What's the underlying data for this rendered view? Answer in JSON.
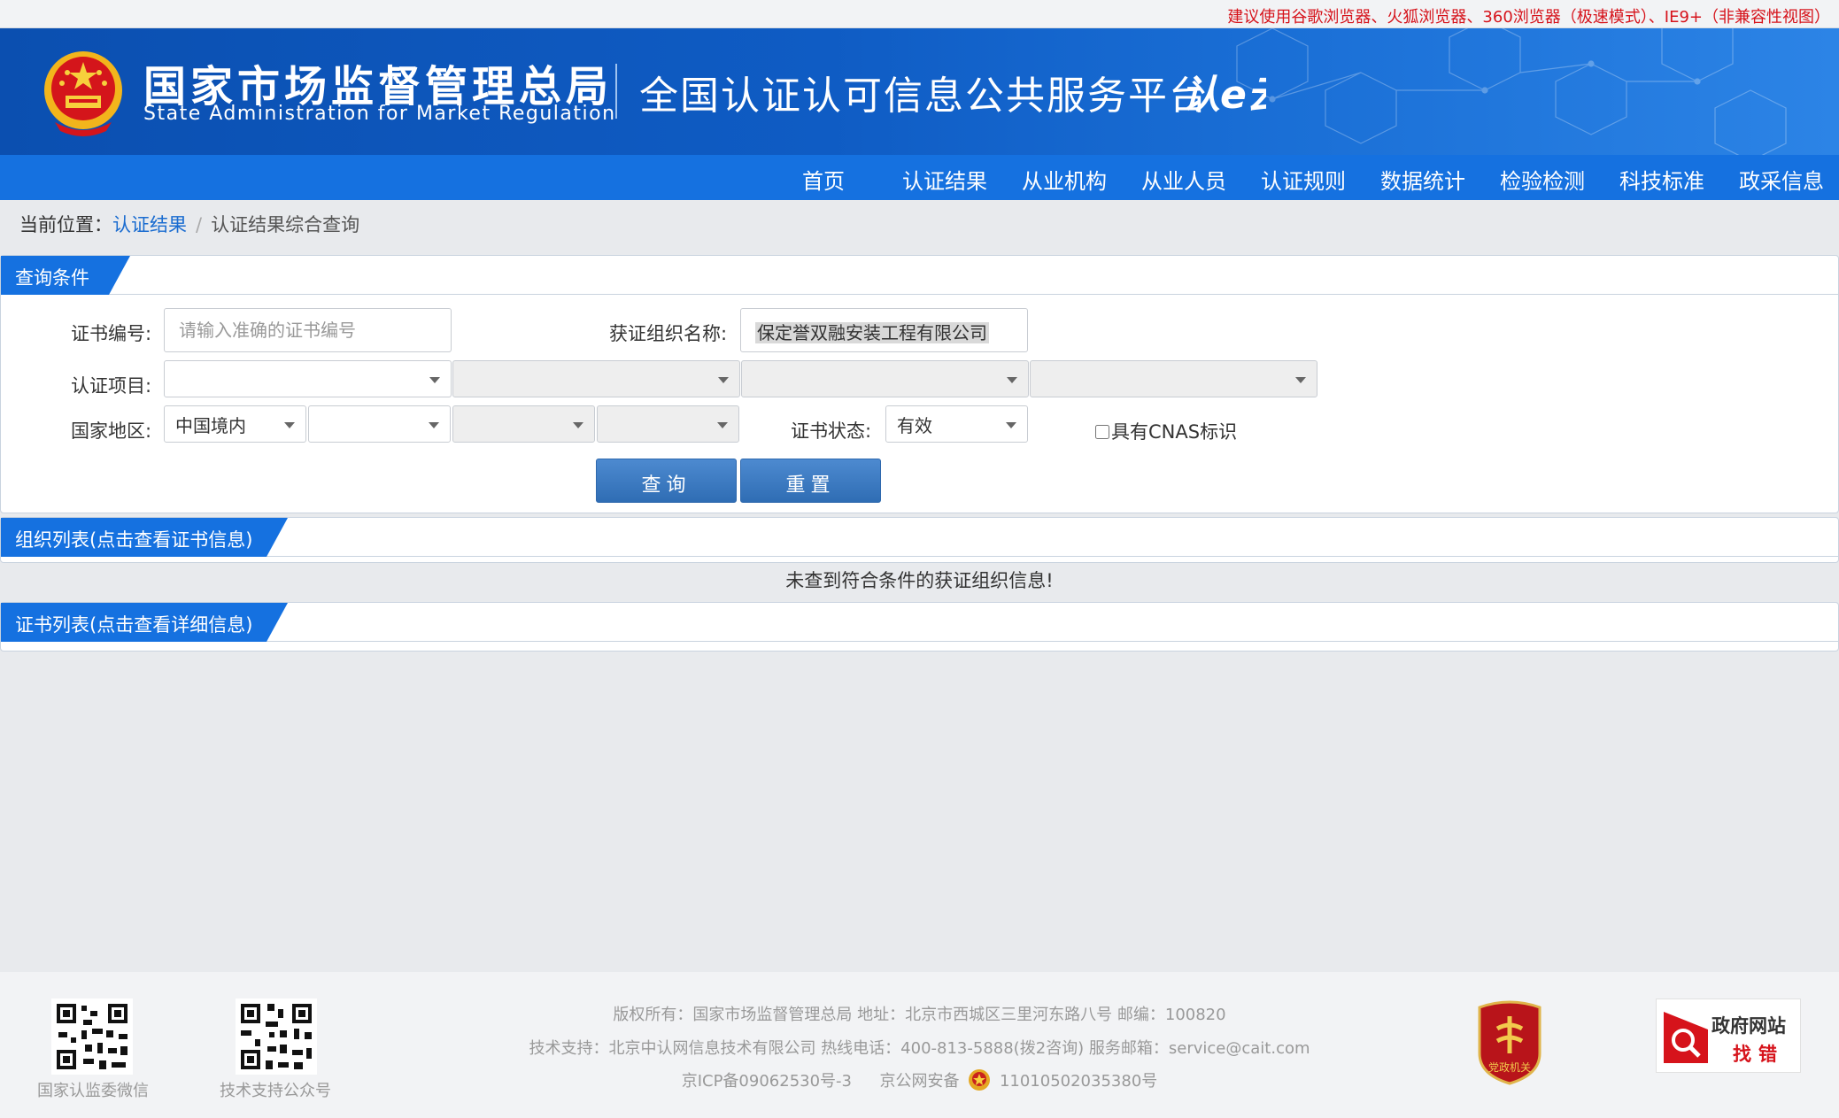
{
  "notice": "建议使用谷歌浏览器、火狐浏览器、360浏览器（极速模式）、IE9+（非兼容性视图）",
  "header": {
    "org_cn": "国家市场监督管理总局",
    "org_en": "State Administration  for  Market Regulation",
    "platform": "全国认证认可信息公共服务平台",
    "platform_logo_text": "认e云"
  },
  "nav": [
    "首页",
    "认证结果",
    "从业机构",
    "从业人员",
    "认证规则",
    "数据统计",
    "检验检测",
    "科技标准",
    "政采信息"
  ],
  "breadcrumb": {
    "label": "当前位置：",
    "link": "认证结果",
    "sep": "/",
    "current": "认证结果综合查询"
  },
  "query": {
    "title": "查询条件",
    "cert_no_label": "证书编号:",
    "cert_no_placeholder": "请输入准确的证书编号",
    "org_name_label": "获证组织名称:",
    "org_name_value": "保定誉双融安装工程有限公司",
    "project_label": "认证项目:",
    "region_label": "国家地区:",
    "region_value": "中国境内",
    "status_label": "证书状态:",
    "status_value": "有效",
    "cnas_label": "具有CNAS标识",
    "search_btn": "查询",
    "reset_btn": "重置"
  },
  "org_list": {
    "title": "组织列表(点击查看证书信息)",
    "empty": "未查到符合条件的获证组织信息!"
  },
  "cert_list": {
    "title": "证书列表(点击查看详细信息)"
  },
  "footer": {
    "qr1_caption": "国家认监委微信",
    "qr2_caption": "技术支持公众号",
    "line1": "版权所有：国家市场监督管理总局    地址：北京市西城区三里河东路八号    邮编：100820",
    "line2": "技术支持：北京中认网信息技术有限公司    热线电话：400-813-5888(拨2咨询)    服务邮箱：service@cait.com",
    "icp": "京ICP备09062530号-3",
    "police": "京公网安备",
    "police_no": "11010502035380号",
    "badge_text": "党政机关",
    "gov_t1": "政府网站",
    "gov_t2": "找错"
  },
  "colors": {
    "brand_blue": "#1571e0",
    "notice_red": "#d6131b",
    "link_blue": "#1a6cd0"
  }
}
